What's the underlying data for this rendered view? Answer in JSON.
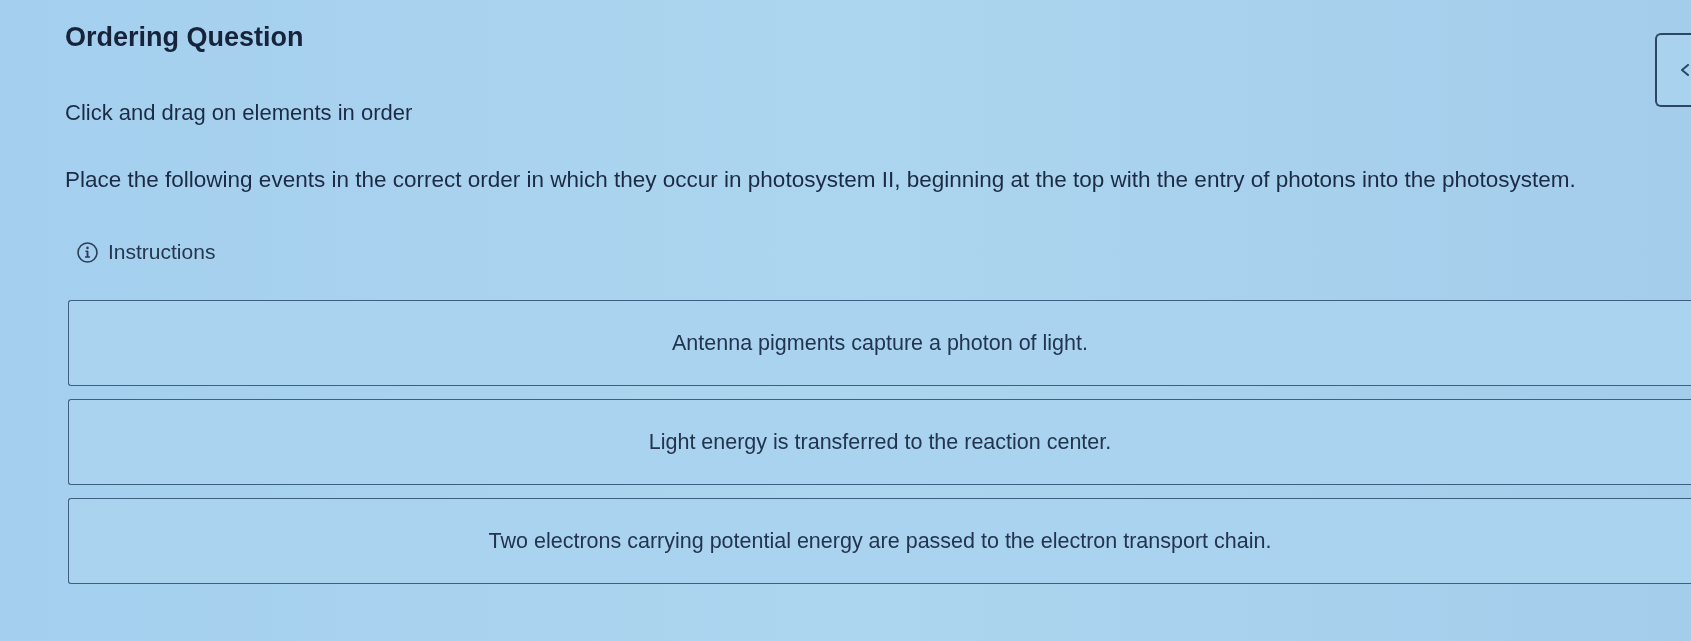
{
  "title": "Ordering Question",
  "prompt": "Click and drag on elements in order",
  "question": "Place the following events in the correct order in which they occur in photosystem II, beginning at the top with the entry of photons into the photosystem.",
  "instructions": {
    "label": "Instructions"
  },
  "items": [
    {
      "text": "Antenna pigments capture a photon of light."
    },
    {
      "text": "Light energy is transferred to the reaction center."
    },
    {
      "text": "Two electrons carrying potential energy are passed to the electron transport chain."
    }
  ]
}
